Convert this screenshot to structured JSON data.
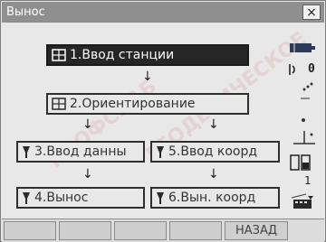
{
  "window": {
    "title": "Вынос",
    "close_glyph": "×"
  },
  "buttons": {
    "station": "1.Ввод станции",
    "orient": "2.Ориентирование",
    "data_input": "3.Ввод данны",
    "coord_input": "5.Ввод коорд",
    "stakeout": "4.Вынос",
    "stakeout_coord": "6.Вын. коорд"
  },
  "arrow_glyph": "↓",
  "sidebar": {
    "zero_label": "0",
    "one_label": "1"
  },
  "footer": {
    "back_label": "НАЗАД"
  },
  "watermark": {
    "line1": "ПРОФСНАБ",
    "line2": "ГЕОДЕЗИЧЕСКОЕ"
  },
  "colors": {
    "titlebar": "#8f8f8f",
    "selected_button": "#262626",
    "background": "#e8e8e8"
  }
}
